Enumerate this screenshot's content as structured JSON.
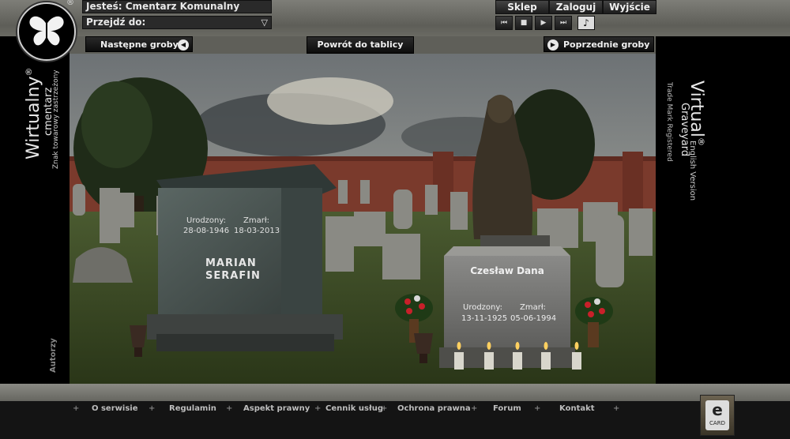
{
  "header": {
    "location_label": "Jesteś:",
    "location_value": "Cmentarz Komunalny",
    "goto_label": "Przejdź do:",
    "goto_value": "",
    "buttons": {
      "shop": "Sklep",
      "login": "Zaloguj",
      "exit": "Wyjście"
    },
    "reg_mark": "®"
  },
  "player": {
    "prev": "⏮",
    "stop": "■",
    "play": "▶",
    "next": "⏭",
    "music": "♪"
  },
  "nav": {
    "next_graves": "Następne groby",
    "back_to_board": "Powrót do tablicy",
    "prev_graves": "Poprzednie groby"
  },
  "left_brand": {
    "title": "Wirtualny",
    "reg": "®",
    "subtitle": "cmentarz",
    "trademark": "Znak towarowy zastrzeżony",
    "authors": "Autorzy"
  },
  "right_brand": {
    "title": "Virtual",
    "reg": "®",
    "subtitle": "Graveyard",
    "english": "English Version",
    "trademark": "Trade Mark Registered"
  },
  "graves": [
    {
      "name_line1": "MARIAN",
      "name_line2": "SERAFIN",
      "born_label": "Urodzony:",
      "born": "28-08-1946",
      "died_label": "Zmarł:",
      "died": "18-03-2013"
    },
    {
      "name_line1": "Czesław Dana",
      "born_label": "Urodzony:",
      "born": "13-11-1925",
      "died_label": "Zmarł:",
      "died": "05-06-1994"
    }
  ],
  "footer": {
    "items": [
      "O serwisie",
      "Regulamin",
      "Aspekt prawny",
      "Cennik usług",
      "Ochrona prawna",
      "Forum",
      "Kontakt"
    ],
    "plus": "+",
    "ecard_label": "CARD",
    "ecard_letter": "e"
  }
}
